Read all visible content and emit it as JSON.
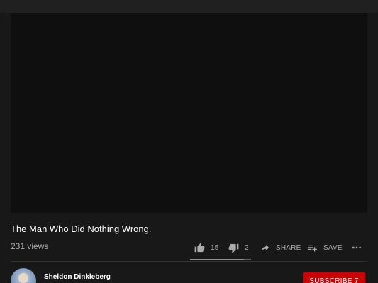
{
  "video": {
    "title": "The Man Who Did Nothing Wrong.",
    "views": "231 views"
  },
  "actions": {
    "like_count": "15",
    "dislike_count": "2",
    "share_label": "SHARE",
    "save_label": "SAVE"
  },
  "sentiment": {
    "like_fraction": 0.88
  },
  "channel": {
    "name": "Sheldon Dinkleberg",
    "subscribe_label": "SUBSCRIBE 7"
  },
  "colors": {
    "background": "#181818",
    "player": "#0f0f0f",
    "subscribe": "#cc0000",
    "secondary_text": "#aaaaaa"
  },
  "icons": {
    "like": "thumb-up-icon",
    "dislike": "thumb-down-icon",
    "share": "share-arrow-icon",
    "save": "playlist-add-icon",
    "more": "more-horizontal-icon"
  }
}
